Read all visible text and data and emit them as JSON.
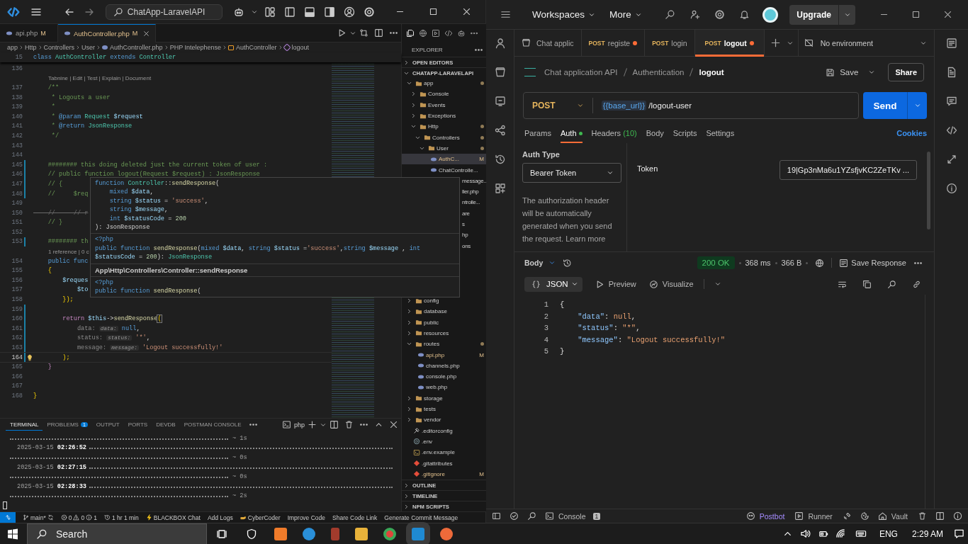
{
  "vscode": {
    "command_center": "ChatApp-LaravelAPI",
    "tabs": [
      {
        "label": "api.php",
        "badge": "M",
        "selected": false
      },
      {
        "label": "AuthController.php",
        "badge": "M",
        "selected": true
      }
    ],
    "breadcrumbs": [
      {
        "text": "app",
        "kind": "plain"
      },
      {
        "text": "Http",
        "kind": "plain"
      },
      {
        "text": "Controllers",
        "kind": "plain"
      },
      {
        "text": "User",
        "kind": "plain"
      },
      {
        "text": "AuthController.php",
        "kind": "php"
      },
      {
        "text": "PHP Intelephense",
        "kind": "plain"
      },
      {
        "text": "AuthController",
        "kind": "class"
      },
      {
        "text": "logout",
        "kind": "method"
      }
    ],
    "sticky": {
      "number": "15",
      "tokens": [
        {
          "text": "class",
          "kind": "kw"
        },
        {
          "text": " AuthController",
          "kind": "cls"
        },
        {
          "text": " extends",
          "kind": "kw"
        },
        {
          "text": " Controller",
          "kind": "cls"
        }
      ]
    },
    "lines": [
      {
        "kind": "code",
        "number": "136",
        "changed": false,
        "current": false
      },
      {
        "kind": "lens",
        "text": "Tabnine | Edit | Test | Explain | Document"
      },
      {
        "kind": "code",
        "number": "137",
        "changed": false,
        "current": false,
        "tokens": [
          {
            "text": "    /**",
            "kind": "cm"
          }
        ]
      },
      {
        "kind": "code",
        "number": "138",
        "changed": false,
        "current": false,
        "tokens": [
          {
            "text": "     * Logouts a user",
            "kind": "cm"
          }
        ]
      },
      {
        "kind": "code",
        "number": "139",
        "changed": false,
        "current": false,
        "tokens": [
          {
            "text": "     *",
            "kind": "cm"
          }
        ]
      },
      {
        "kind": "code",
        "number": "140",
        "changed": false,
        "current": false,
        "tokens": [
          {
            "text": "     * ",
            "kind": "cm"
          },
          {
            "text": "@param",
            "kind": "kw"
          },
          {
            "text": " Request",
            "kind": "cls"
          },
          {
            "text": " $request",
            "kind": "var"
          }
        ]
      },
      {
        "kind": "code",
        "number": "141",
        "changed": false,
        "current": false,
        "tokens": [
          {
            "text": "     * ",
            "kind": "cm"
          },
          {
            "text": "@return",
            "kind": "kw"
          },
          {
            "text": " JsonResponse",
            "kind": "cls"
          }
        ]
      },
      {
        "kind": "code",
        "number": "142",
        "changed": false,
        "current": false,
        "tokens": [
          {
            "text": "     */",
            "kind": "cm"
          }
        ]
      },
      {
        "kind": "code",
        "number": "143",
        "changed": false,
        "current": false
      },
      {
        "kind": "code",
        "number": "144",
        "changed": false,
        "current": false
      },
      {
        "kind": "code",
        "number": "145",
        "changed": true,
        "current": false,
        "tokens": [
          {
            "text": "    ######## this doing deleted just the current token of user :",
            "kind": "cm"
          }
        ]
      },
      {
        "kind": "code",
        "number": "146",
        "changed": true,
        "current": false,
        "tokens": [
          {
            "text": "    // public function logout(Request $request) : JsonResponse",
            "kind": "cm"
          }
        ]
      },
      {
        "kind": "code",
        "number": "147",
        "changed": true,
        "current": false,
        "tokens": [
          {
            "text": "    // {",
            "kind": "cm"
          }
        ]
      },
      {
        "kind": "code",
        "number": "148",
        "changed": true,
        "current": false,
        "tokens": [
          {
            "text": "    //     $req",
            "kind": "cm"
          }
        ]
      },
      {
        "kind": "code",
        "number": "149",
        "changed": false,
        "current": false
      },
      {
        "kind": "code",
        "number": "150",
        "changed": false,
        "current": false,
        "tokens": [
          {
            "text": "    //     // r",
            "kind": "dim"
          }
        ]
      },
      {
        "kind": "code",
        "number": "151",
        "changed": false,
        "current": false,
        "tokens": [
          {
            "text": "    // }",
            "kind": "cm"
          }
        ]
      },
      {
        "kind": "code",
        "number": "152",
        "changed": false,
        "current": false
      },
      {
        "kind": "code",
        "number": "153",
        "changed": true,
        "current": false,
        "tokens": [
          {
            "text": "    ######## th",
            "kind": "cm"
          }
        ]
      },
      {
        "kind": "lens",
        "text": "1 reference | 0 c"
      },
      {
        "kind": "code",
        "number": "154",
        "changed": false,
        "current": false,
        "tokens": [
          {
            "text": "    public",
            "kind": "kw"
          },
          {
            "text": " func",
            "kind": "kw"
          }
        ]
      },
      {
        "kind": "code",
        "number": "155",
        "changed": false,
        "current": false,
        "tokens": [
          {
            "text": "    {",
            "kind": "brace"
          }
        ]
      },
      {
        "kind": "code",
        "number": "156",
        "changed": false,
        "current": false,
        "tokens": [
          {
            "text": "        $reques",
            "kind": "var"
          }
        ]
      },
      {
        "kind": "code",
        "number": "157",
        "changed": false,
        "current": false,
        "tokens": [
          {
            "text": "            $to",
            "kind": "var"
          }
        ]
      },
      {
        "kind": "code",
        "number": "158",
        "changed": false,
        "current": false,
        "tokens": [
          {
            "text": "        });",
            "kind": "brace"
          }
        ]
      },
      {
        "kind": "code",
        "number": "159",
        "changed": true,
        "current": false
      },
      {
        "kind": "code",
        "number": "160",
        "changed": true,
        "current": false,
        "tokens": [
          {
            "text": "        return ",
            "kind": "ctl"
          },
          {
            "text": "$this",
            "kind": "var"
          },
          {
            "text": "->",
            "kind": "pl"
          },
          {
            "text": "sendResponse",
            "kind": "fn"
          },
          {
            "text": "(",
            "kind": "match"
          }
        ]
      },
      {
        "kind": "code",
        "number": "161",
        "changed": true,
        "current": false,
        "tokens": [
          {
            "text": "            data: ",
            "kind": "gray"
          },
          {
            "text": "data:",
            "kind": "hint"
          },
          {
            "text": " null",
            "kind": "kw"
          },
          {
            "text": ",",
            "kind": "pl"
          }
        ]
      },
      {
        "kind": "code",
        "number": "162",
        "changed": true,
        "current": false,
        "tokens": [
          {
            "text": "            status: ",
            "kind": "gray"
          },
          {
            "text": "status:",
            "kind": "hint"
          },
          {
            "text": " '*'",
            "kind": "str"
          },
          {
            "text": ",",
            "kind": "pl"
          }
        ]
      },
      {
        "kind": "code",
        "number": "163",
        "changed": true,
        "current": false,
        "tokens": [
          {
            "text": "            message: ",
            "kind": "gray"
          },
          {
            "text": "message:",
            "kind": "hint"
          },
          {
            "text": " 'Logout successfully!'",
            "kind": "str"
          }
        ]
      },
      {
        "kind": "code",
        "number": "164",
        "changed": true,
        "current": true,
        "tokens": [
          {
            "text": "        );",
            "kind": "brace"
          }
        ]
      },
      {
        "kind": "code",
        "number": "165",
        "changed": false,
        "current": false,
        "tokens": [
          {
            "text": "    }",
            "kind": "ctl"
          }
        ]
      },
      {
        "kind": "code",
        "number": "166",
        "changed": false,
        "current": false
      },
      {
        "kind": "code",
        "number": "167",
        "changed": false,
        "current": false
      },
      {
        "kind": "code",
        "number": "168",
        "changed": false,
        "current": false,
        "tokens": [
          {
            "text": "}",
            "kind": "brace"
          }
        ]
      }
    ],
    "hover": [
      {
        "kind": "code",
        "lines": [
          [
            {
              "text": "function",
              "kind": "kw"
            },
            {
              "text": " Controller",
              "kind": "cls"
            },
            {
              "text": "::",
              "kind": "pl"
            },
            {
              "text": "sendResponse",
              "kind": "fn"
            },
            {
              "text": "(",
              "kind": "pl"
            }
          ],
          [
            {
              "text": "    mixed",
              "kind": "kw"
            },
            {
              "text": " $data",
              "kind": "var"
            },
            {
              "text": ",",
              "kind": "pl"
            }
          ],
          [
            {
              "text": "    string",
              "kind": "kw"
            },
            {
              "text": " $status",
              "kind": "var"
            },
            {
              "text": " = ",
              "kind": "pl"
            },
            {
              "text": "'success'",
              "kind": "str"
            },
            {
              "text": ",",
              "kind": "pl"
            }
          ],
          [
            {
              "text": "    string",
              "kind": "kw"
            },
            {
              "text": " $message",
              "kind": "var"
            },
            {
              "text": ",",
              "kind": "pl"
            }
          ],
          [
            {
              "text": "    int",
              "kind": "kw"
            },
            {
              "text": " $statusCode",
              "kind": "var"
            },
            {
              "text": " = ",
              "kind": "pl"
            },
            {
              "text": "200",
              "kind": "num"
            }
          ],
          [
            {
              "text": "): JsonResponse",
              "kind": "pl"
            }
          ]
        ]
      },
      {
        "kind": "code",
        "lines": [
          [
            {
              "text": "<?php",
              "kind": "kw"
            }
          ],
          [
            {
              "text": "public function",
              "kind": "kw"
            },
            {
              "text": " sendResponse",
              "kind": "fn"
            },
            {
              "text": "(",
              "kind": "pl"
            },
            {
              "text": "mixed",
              "kind": "kw"
            },
            {
              "text": " $data",
              "kind": "var"
            },
            {
              "text": ", ",
              "kind": "pl"
            },
            {
              "text": "string",
              "kind": "kw"
            },
            {
              "text": " $status",
              "kind": "var"
            },
            {
              "text": " =",
              "kind": "pl"
            },
            {
              "text": "'success'",
              "kind": "str"
            },
            {
              "text": ",",
              "kind": "pl"
            },
            {
              "text": "string",
              "kind": "kw"
            },
            {
              "text": " $message",
              "kind": "var"
            },
            {
              "text": " , ",
              "kind": "pl"
            },
            {
              "text": "int",
              "kind": "kw"
            }
          ],
          [
            {
              "text": "$statusCode",
              "kind": "var"
            },
            {
              "text": " = ",
              "kind": "pl"
            },
            {
              "text": "200",
              "kind": "num"
            },
            {
              "text": "): ",
              "kind": "pl"
            },
            {
              "text": "JsonResponse",
              "kind": "cls"
            }
          ]
        ]
      },
      {
        "kind": "title",
        "text": "App\\Http\\Controllers\\Controller::sendResponse"
      },
      {
        "kind": "code",
        "lines": [
          [
            {
              "text": "<?php",
              "kind": "kw"
            }
          ],
          [
            {
              "text": "public function",
              "kind": "kw"
            },
            {
              "text": " sendResponse",
              "kind": "fn"
            },
            {
              "text": "(",
              "kind": "pl"
            }
          ]
        ]
      }
    ],
    "panel_tabs": [
      {
        "label": "TERMINAL",
        "selected": true
      },
      {
        "label": "PROBLEMS",
        "count": "1",
        "selected": false
      },
      {
        "label": "OUTPUT",
        "selected": false
      },
      {
        "label": "PORTS",
        "selected": false
      },
      {
        "label": "DEVDB",
        "selected": false
      },
      {
        "label": "POSTMAN CONSOLE",
        "selected": false
      }
    ],
    "terminal_shell": "php",
    "terminal": [
      {
        "kind": "leader",
        "text": "~ 1s"
      },
      {
        "kind": "stamp",
        "date": "2025-03-15",
        "time": "02:26:52"
      },
      {
        "kind": "leader",
        "text": "~ 0s"
      },
      {
        "kind": "stamp",
        "date": "2025-03-15",
        "time": "02:27:15"
      },
      {
        "kind": "leader",
        "text": "~ 0s"
      },
      {
        "kind": "stamp",
        "date": "2025-03-15",
        "time": "02:28:33"
      },
      {
        "kind": "leader",
        "text": "~ 2s"
      },
      {
        "kind": "cursor"
      }
    ],
    "explorer": {
      "title": "EXPLORER",
      "sections": [
        {
          "label": "OPEN EDITORS",
          "expanded": false
        },
        {
          "label": "CHATAPP-LARAVELAPI",
          "expanded": true,
          "items": [
            {
              "label": "app",
              "kind": "folder",
              "expanded": true,
              "modified": true,
              "selected": false,
              "children": [
                {
                  "label": "Console",
                  "kind": "folder",
                  "expanded": false,
                  "modified": false,
                  "selected": false
                },
                {
                  "label": "Events",
                  "kind": "folder",
                  "expanded": false,
                  "modified": false,
                  "selected": false
                },
                {
                  "label": "Exceptions",
                  "kind": "folder",
                  "expanded": false,
                  "modified": false,
                  "selected": false
                },
                {
                  "label": "Http",
                  "kind": "folder",
                  "expanded": true,
                  "modified": true,
                  "selected": false,
                  "children": [
                    {
                      "label": "Controllers",
                      "kind": "folder",
                      "expanded": true,
                      "modified": true,
                      "selected": false,
                      "children": [
                        {
                          "label": "User",
                          "kind": "folder",
                          "expanded": true,
                          "modified": true,
                          "selected": false,
                          "children": [
                            {
                              "label": "AuthC...",
                              "kind": "php",
                              "badge": "M",
                              "selected": true
                            },
                            {
                              "label": "ChatControlle...",
                              "kind": "php",
                              "selected": false
                            }
                          ]
                        },
                        {
                          "label": "message...",
                          "kind": "covered",
                          "selected": false
                        },
                        {
                          "label": "ller.php",
                          "kind": "covered",
                          "selected": false
                        },
                        {
                          "label": "ntrolle...",
                          "kind": "covered",
                          "selected": false
                        },
                        {
                          "label": "are",
                          "kind": "covered",
                          "selected": false
                        },
                        {
                          "label": "s",
                          "kind": "covered",
                          "selected": false
                        },
                        {
                          "label": "hp",
                          "kind": "covered",
                          "selected": false
                        },
                        {
                          "label": "ons",
                          "kind": "covered",
                          "selected": false
                        }
                      ]
                    }
                  ]
                }
              ]
            },
            {
              "label": "config",
              "kind": "folder",
              "expanded": false,
              "modified": false,
              "selected": false
            },
            {
              "label": "database",
              "kind": "folder",
              "expanded": false,
              "modified": false,
              "selected": false
            },
            {
              "label": "public",
              "kind": "folder",
              "expanded": false,
              "modified": false,
              "selected": false
            },
            {
              "label": "resources",
              "kind": "folder",
              "expanded": false,
              "modified": false,
              "selected": false
            },
            {
              "label": "routes",
              "kind": "folder",
              "expanded": true,
              "modified": true,
              "selected": false,
              "children": [
                {
                  "label": "api.php",
                  "kind": "php",
                  "badge": "M",
                  "selected": false
                },
                {
                  "label": "channels.php",
                  "kind": "php",
                  "selected": false
                },
                {
                  "label": "console.php",
                  "kind": "php",
                  "selected": false
                },
                {
                  "label": "web.php",
                  "kind": "php",
                  "selected": false
                }
              ]
            },
            {
              "label": "storage",
              "kind": "folder",
              "expanded": false,
              "modified": false,
              "selected": false
            },
            {
              "label": "tests",
              "kind": "folder",
              "expanded": false,
              "modified": false,
              "selected": false
            },
            {
              "label": "vendor",
              "kind": "folder",
              "expanded": false,
              "modified": false,
              "selected": false
            },
            {
              "label": ".editorconfig",
              "kind": "editorconfig",
              "selected": false
            },
            {
              "label": ".env",
              "kind": "gear",
              "selected": false
            },
            {
              "label": ".env.example",
              "kind": "terminal",
              "selected": false
            },
            {
              "label": ".gitattributes",
              "kind": "git",
              "selected": false
            },
            {
              "label": ".gitignore",
              "kind": "git",
              "badge": "M",
              "selected": false
            }
          ]
        },
        {
          "label": "OUTLINE",
          "expanded": false
        },
        {
          "label": "TIMELINE",
          "expanded": false
        },
        {
          "label": "NPM SCRIPTS",
          "expanded": false
        }
      ]
    },
    "status_bar": [
      {
        "kind": "remote"
      },
      {
        "kind": "branch",
        "text": "main*"
      },
      {
        "kind": "problems",
        "errors": "0",
        "warnings": "0",
        "infos": "1"
      },
      {
        "kind": "time",
        "text": "1 hr 1 min"
      },
      {
        "kind": "bolt",
        "text": "BLACKBOX Chat"
      },
      {
        "kind": "plain",
        "text": "Add Logs"
      },
      {
        "kind": "hand",
        "text": "CyberCoder"
      },
      {
        "kind": "plain",
        "text": "Improve Code"
      },
      {
        "kind": "plain",
        "text": "Share Code Link"
      },
      {
        "kind": "plain",
        "text": "Generate Commit Message"
      }
    ]
  },
  "postman": {
    "nav": [
      "Workspaces",
      "More"
    ],
    "upgrade": "Upgrade",
    "tabs": [
      {
        "kind": "collection",
        "label": "Chat applic",
        "unsaved": false,
        "selected": false
      },
      {
        "kind": "request",
        "method": "POST",
        "label": "registe",
        "unsaved": true,
        "selected": false
      },
      {
        "kind": "request",
        "method": "POST",
        "label": "login",
        "unsaved": false,
        "selected": false
      },
      {
        "kind": "request",
        "method": "POST",
        "label": "logout",
        "unsaved": true,
        "selected": true
      }
    ],
    "environment": "No environment",
    "breadcrumb": [
      "Chat application API",
      "Authentication",
      "logout"
    ],
    "save": "Save",
    "share": "Share",
    "method": "POST",
    "url_variable": "{{base_url}}",
    "url_path": "/logout-user",
    "send": "Send",
    "request_tabs": [
      {
        "label": "Params",
        "configured": false,
        "selected": false
      },
      {
        "label": "Auth",
        "configured": true,
        "selected": true
      },
      {
        "label": "Headers",
        "count": "(10)",
        "configured": false,
        "selected": false
      },
      {
        "label": "Body",
        "configured": false,
        "selected": false
      },
      {
        "label": "Scripts",
        "configured": false,
        "selected": false
      },
      {
        "label": "Settings",
        "configured": false,
        "selected": false
      }
    ],
    "cookies": "Cookies",
    "auth": {
      "type_label": "Auth Type",
      "type": "Bearer Token",
      "note": "The authorization header will be automatically generated when you send the request.",
      "link": "Learn more",
      "token_label": "Token",
      "token": "19|Gp3nMa6u1YZsfjvKC2ZeTKv ..."
    },
    "response": {
      "view": "Body",
      "status": "200 OK",
      "time": "368 ms",
      "size": "366 B",
      "save": "Save Response",
      "format": "JSON",
      "preview": "Preview",
      "visualize": "Visualize",
      "lines": [
        {
          "number": "1",
          "tokens": [
            {
              "text": "{",
              "kind": "punct"
            }
          ]
        },
        {
          "number": "2",
          "tokens": [
            {
              "text": "    \"data\"",
              "kind": "key"
            },
            {
              "text": ": ",
              "kind": "punct"
            },
            {
              "text": "null",
              "kind": "value"
            },
            {
              "text": ",",
              "kind": "punct"
            }
          ]
        },
        {
          "number": "3",
          "tokens": [
            {
              "text": "    \"status\"",
              "kind": "key"
            },
            {
              "text": ": ",
              "kind": "punct"
            },
            {
              "text": "\"*\"",
              "kind": "value"
            },
            {
              "text": ",",
              "kind": "punct"
            }
          ]
        },
        {
          "number": "4",
          "tokens": [
            {
              "text": "    \"message\"",
              "kind": "key"
            },
            {
              "text": ": ",
              "kind": "punct"
            },
            {
              "text": "\"Logout successfully!\"",
              "kind": "value"
            }
          ]
        },
        {
          "number": "5",
          "tokens": [
            {
              "text": "}",
              "kind": "punct"
            }
          ]
        }
      ]
    },
    "footer": {
      "console": "Console",
      "console_count": "1",
      "tools": [
        {
          "kind": "postbot",
          "text": "Postbot"
        },
        {
          "kind": "runner",
          "text": "Runner"
        },
        {
          "kind": "vault",
          "text": "Vault"
        }
      ]
    }
  },
  "taskbar": {
    "search": "Search",
    "language": "ENG",
    "time": "2:29 AM"
  }
}
